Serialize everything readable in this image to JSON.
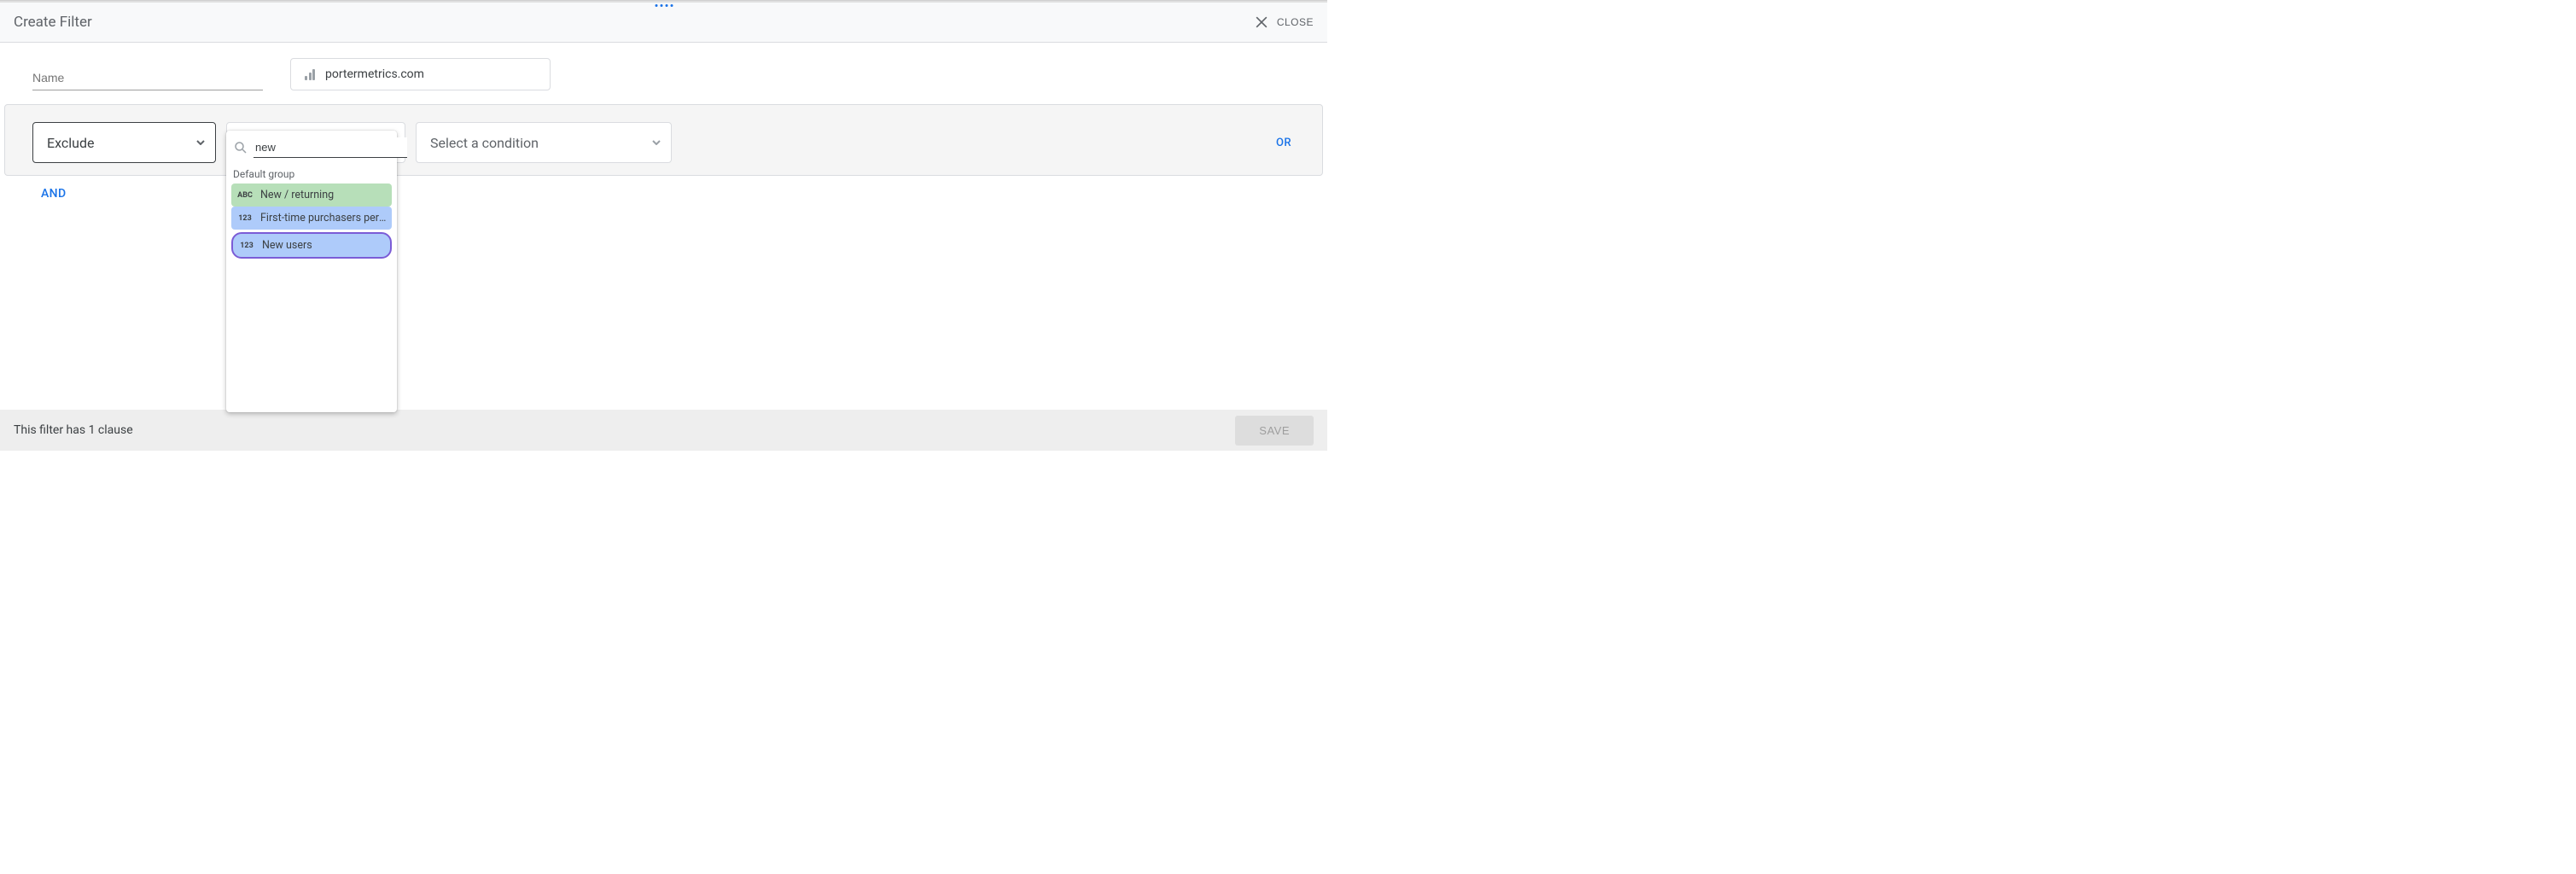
{
  "drag_handle_dots": 4,
  "header": {
    "title": "Create Filter",
    "close_label": "CLOSE"
  },
  "meta": {
    "name_placeholder": "Name",
    "name_value": "",
    "datasource": "portermetrics.com"
  },
  "filter": {
    "include_exclude": "Exclude",
    "condition_placeholder": "Select a condition",
    "or_label": "OR",
    "and_label": "AND",
    "dimension_dropdown": {
      "search_value": "new",
      "group_label": "Default group",
      "options": [
        {
          "type": "ABC",
          "label": "New / returning",
          "style": "green"
        },
        {
          "type": "123",
          "label": "First-time purchasers per n…",
          "style": "blue"
        },
        {
          "type": "123",
          "label": "New users",
          "style": "highlight"
        }
      ]
    }
  },
  "footer": {
    "status_text": "This filter has 1 clause",
    "save_label": "SAVE"
  }
}
